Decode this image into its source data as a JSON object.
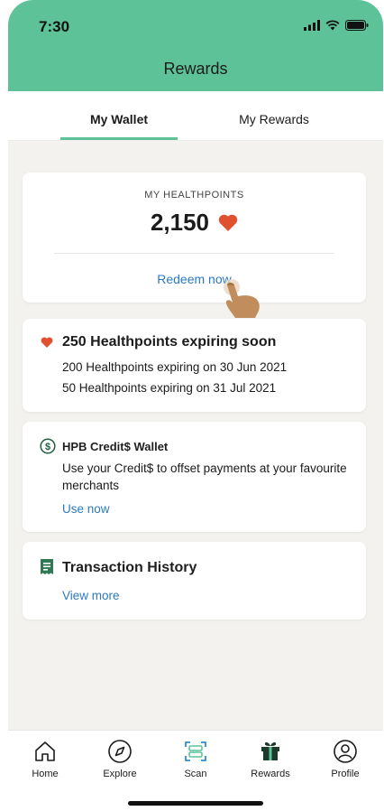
{
  "status": {
    "time": "7:30"
  },
  "header": {
    "title": "Rewards"
  },
  "tabs": [
    {
      "label": "My Wallet",
      "active": true
    },
    {
      "label": "My Rewards",
      "active": false
    }
  ],
  "healthpoints": {
    "label": "MY HEALTHPOINTS",
    "value": "2,150",
    "redeem_label": "Redeem now"
  },
  "expiry": {
    "title": "250 Healthpoints expiring soon",
    "lines": [
      "200 Healthpoints expiring on 30 Jun 2021",
      "50 Healthpoints expiring on 31 Jul 2021"
    ]
  },
  "credit_wallet": {
    "title": "HPB Credit$ Wallet",
    "description": "Use your Credit$ to offset payments at your favourite merchants",
    "link": "Use now"
  },
  "history": {
    "title": "Transaction History",
    "link": "View more"
  },
  "nav": [
    {
      "label": "Home",
      "icon": "home-icon"
    },
    {
      "label": "Explore",
      "icon": "compass-icon"
    },
    {
      "label": "Scan",
      "icon": "scan-icon"
    },
    {
      "label": "Rewards",
      "icon": "gift-icon"
    },
    {
      "label": "Profile",
      "icon": "profile-icon"
    }
  ],
  "colors": {
    "brand_green": "#5dc298",
    "link_blue": "#2d7ac0",
    "heart_red": "#e0522f",
    "background": "#f3f2ef"
  }
}
